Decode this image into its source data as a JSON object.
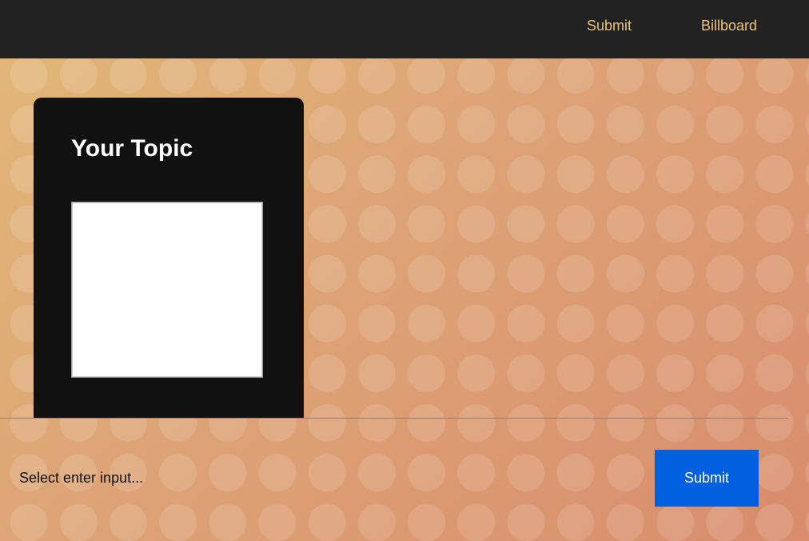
{
  "nav": {
    "submit_label": "Submit",
    "billboard_label": "Billboard"
  },
  "topic_card": {
    "title": "Your Topic"
  },
  "input": {
    "placeholder": "Select enter input...",
    "value": ""
  },
  "submit_button": {
    "label": "Submit"
  },
  "colors": {
    "nav_background": "#222222",
    "nav_link": "#e9c47a",
    "card_background": "#111111",
    "submit_button": "#0060df"
  }
}
